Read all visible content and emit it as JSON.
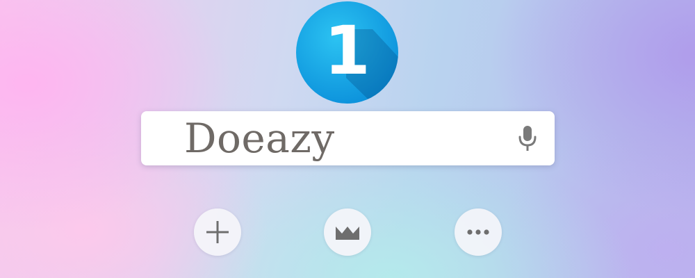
{
  "logo": {
    "number": "1",
    "icon": "number-one-badge-icon",
    "color": "#1aa7e6"
  },
  "search": {
    "value": "Doeazy",
    "mic_icon": "microphone-icon"
  },
  "actions": [
    {
      "name": "add",
      "icon": "plus-icon"
    },
    {
      "name": "crown",
      "icon": "crown-icon"
    },
    {
      "name": "more",
      "icon": "more-horizontal-icon"
    }
  ]
}
